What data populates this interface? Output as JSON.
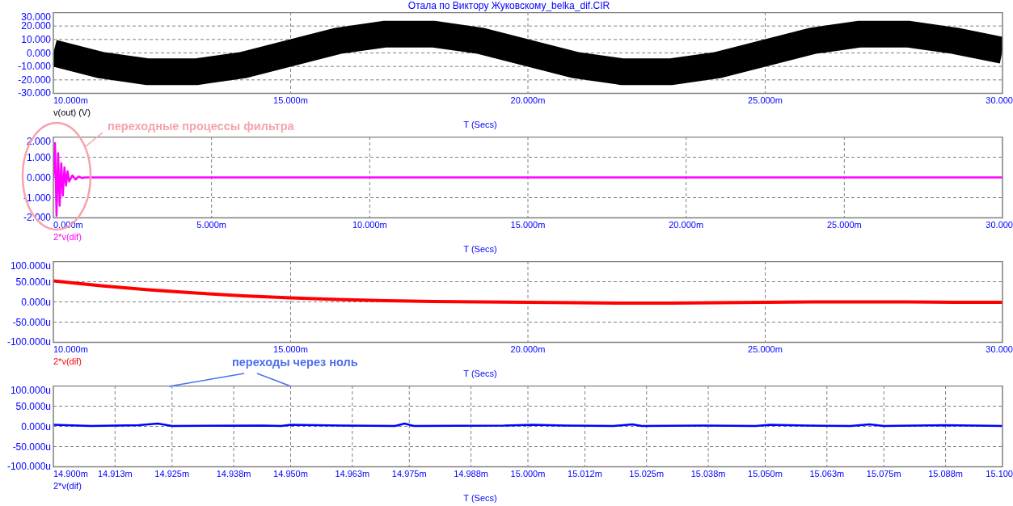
{
  "title": "Отала по Виктору Жуковскому_belka_dif.CIR",
  "panels": [
    {
      "kind": "band",
      "chart_data": {
        "type": "line",
        "grid": true,
        "xlabel": "T (Secs)",
        "xlim": [
          10,
          30
        ],
        "ylim": [
          -30,
          30
        ],
        "xticks": [
          {
            "value": 10,
            "label": "10.000m"
          },
          {
            "value": 15,
            "label": "15.000m"
          },
          {
            "value": 20,
            "label": "20.000m"
          },
          {
            "value": 25,
            "label": "25.000m"
          },
          {
            "value": 30,
            "label": "30.000"
          }
        ],
        "yticks": [
          {
            "value": 30,
            "label": "30.000"
          },
          {
            "value": 20,
            "label": "20.000"
          },
          {
            "value": 10,
            "label": "10.000"
          },
          {
            "value": 0,
            "label": "0.000"
          },
          {
            "value": -10,
            "label": "-10.000"
          },
          {
            "value": -20,
            "label": "-20.000"
          },
          {
            "value": -30,
            "label": "-30.000"
          }
        ],
        "x": [
          10,
          11,
          12,
          13,
          14,
          15,
          16,
          17,
          18,
          19,
          20,
          21,
          22,
          23,
          24,
          25,
          26,
          27,
          28,
          29,
          30
        ],
        "series": [
          {
            "name": "v(out) (V)",
            "color": "#000000",
            "values": [
              0,
              -9,
              -14,
              -14,
              -9,
              0,
              9,
              14,
              14,
              9,
              0,
              -9,
              -14,
              -14,
              -9,
              0,
              9,
              14,
              14,
              9,
              2
            ]
          }
        ]
      }
    },
    {
      "kind": "line",
      "chart_data": {
        "type": "line",
        "grid": true,
        "xlabel": "T (Secs)",
        "xlim": [
          0,
          30
        ],
        "ylim": [
          -2,
          2
        ],
        "xticks": [
          {
            "value": 0,
            "label": "0.000m"
          },
          {
            "value": 5,
            "label": "5.000m"
          },
          {
            "value": 10,
            "label": "10.000m"
          },
          {
            "value": 15,
            "label": "15.000m"
          },
          {
            "value": 20,
            "label": "20.000m"
          },
          {
            "value": 25,
            "label": "25.000m"
          },
          {
            "value": 30,
            "label": "30.000"
          }
        ],
        "yticks": [
          {
            "value": 2,
            "label": "2.000"
          },
          {
            "value": 1,
            "label": "1.000"
          },
          {
            "value": 0,
            "label": "0.000"
          },
          {
            "value": -1,
            "label": "-1.000"
          },
          {
            "value": -2,
            "label": "-2.000"
          }
        ],
        "x": [
          0,
          0.05,
          0.1,
          0.15,
          0.2,
          0.25,
          0.3,
          0.35,
          0.4,
          0.45,
          0.5,
          0.6,
          0.7,
          0.8,
          0.9,
          1,
          30
        ],
        "series": [
          {
            "name": "2*v(dif)",
            "color": "#ff00ff",
            "values": [
              0,
              1.7,
              -1.9,
              1.2,
              -1.4,
              0.7,
              -0.9,
              0.5,
              -0.4,
              0.3,
              -0.2,
              0.1,
              -0.1,
              0.05,
              -0.03,
              0,
              0
            ]
          }
        ]
      }
    },
    {
      "kind": "line",
      "chart_data": {
        "type": "line",
        "grid": true,
        "xlabel": "T (Secs)",
        "xlim": [
          10,
          30
        ],
        "ylim": [
          -100,
          100
        ],
        "xticks": [
          {
            "value": 10,
            "label": "10.000m"
          },
          {
            "value": 15,
            "label": "15.000m"
          },
          {
            "value": 20,
            "label": "20.000m"
          },
          {
            "value": 25,
            "label": "25.000m"
          },
          {
            "value": 30,
            "label": "30.000"
          }
        ],
        "yticks": [
          {
            "value": 100,
            "label": "100.000u"
          },
          {
            "value": 50,
            "label": "50.000u"
          },
          {
            "value": 0,
            "label": "0.000u"
          },
          {
            "value": -50,
            "label": "-50.000u"
          },
          {
            "value": -100,
            "label": "-100.000u"
          }
        ],
        "x": [
          10,
          11,
          12,
          13,
          14,
          15,
          16,
          17,
          18,
          19,
          20,
          21,
          22,
          23,
          24,
          25,
          26,
          27,
          28,
          29,
          30
        ],
        "series": [
          {
            "name": "2*v(dif)",
            "color": "#ff0000",
            "values": [
              52,
              40,
              30,
              22,
              15,
              10,
              6,
              3,
              1,
              0,
              -1,
              -2,
              -3,
              -3,
              -2,
              -1,
              0,
              0,
              0,
              -1,
              -1
            ]
          }
        ]
      }
    },
    {
      "kind": "line",
      "chart_data": {
        "type": "line",
        "grid": true,
        "xlabel": "T (Secs)",
        "xlim": [
          14.9,
          15.1
        ],
        "ylim": [
          -100,
          100
        ],
        "xticks": [
          {
            "value": 14.9,
            "label": "14.900m"
          },
          {
            "value": 14.913,
            "label": "14.913m"
          },
          {
            "value": 14.925,
            "label": "14.925m"
          },
          {
            "value": 14.938,
            "label": "14.938m"
          },
          {
            "value": 14.95,
            "label": "14.950m"
          },
          {
            "value": 14.963,
            "label": "14.963m"
          },
          {
            "value": 14.975,
            "label": "14.975m"
          },
          {
            "value": 14.988,
            "label": "14.988m"
          },
          {
            "value": 15,
            "label": "15.000m"
          },
          {
            "value": 15.012,
            "label": "15.012m"
          },
          {
            "value": 15.025,
            "label": "15.025m"
          },
          {
            "value": 15.038,
            "label": "15.038m"
          },
          {
            "value": 15.05,
            "label": "15.050m"
          },
          {
            "value": 15.063,
            "label": "15.063m"
          },
          {
            "value": 15.075,
            "label": "15.075m"
          },
          {
            "value": 15.088,
            "label": "15.088m"
          },
          {
            "value": 15.1,
            "label": "15.100"
          }
        ],
        "yticks": [
          {
            "value": 100,
            "label": "100.000u"
          },
          {
            "value": 50,
            "label": "50.000u"
          },
          {
            "value": 0,
            "label": "0.000u"
          },
          {
            "value": -50,
            "label": "-50.000u"
          },
          {
            "value": -100,
            "label": "-100.000u"
          }
        ],
        "x": [
          14.9,
          14.908,
          14.918,
          14.922,
          14.925,
          14.944,
          14.948,
          14.95,
          14.961,
          14.972,
          14.974,
          14.976,
          14.995,
          15.001,
          15.008,
          15.018,
          15.022,
          15.024,
          15.037,
          15.048,
          15.051,
          15.059,
          15.068,
          15.072,
          15.075,
          15.088,
          15.1
        ],
        "series": [
          {
            "name": "2*v(dif)",
            "color": "#0000ff",
            "values": [
              4,
              1,
              3,
              7,
              1,
              2,
              1,
              4,
              2,
              1,
              7,
              1,
              2,
              4,
              2,
              1,
              5,
              1,
              2,
              1,
              4,
              2,
              1,
              5,
              1,
              3,
              1
            ]
          }
        ]
      }
    }
  ],
  "annotations": [
    {
      "kind": "ellipse",
      "text": "переходные процессы фильтра",
      "color": "#f6a3ac"
    },
    {
      "kind": "arrows",
      "text": "переходы через ноль",
      "color": "#4d6ff0"
    }
  ]
}
